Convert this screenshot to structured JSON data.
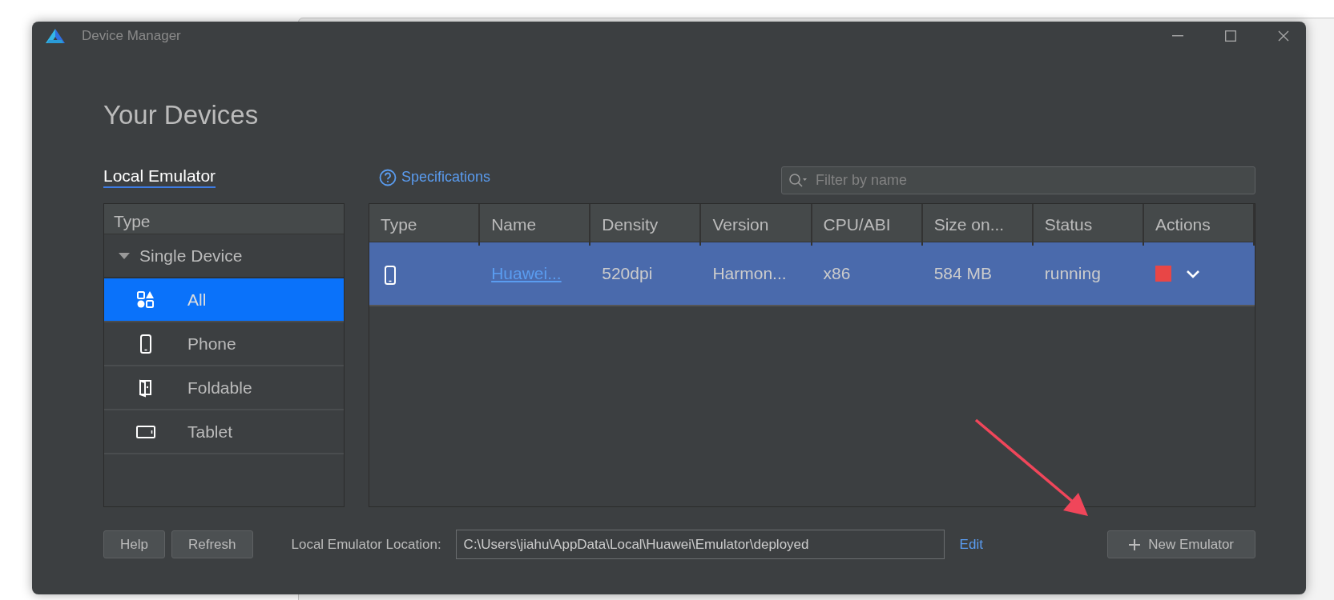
{
  "window": {
    "title": "Device Manager"
  },
  "heading": "Your Devices",
  "tabs": [
    {
      "label": "Local Emulator",
      "selected": true
    }
  ],
  "specifications_link": "Specifications",
  "filter": {
    "placeholder": "Filter by name"
  },
  "type_panel": {
    "header": "Type",
    "groups": [
      {
        "label": "Single Device",
        "expanded": true,
        "children": [
          {
            "label": "All",
            "kind": "all",
            "selected": true
          },
          {
            "label": "Phone",
            "kind": "phone",
            "selected": false
          },
          {
            "label": "Foldable",
            "kind": "foldable",
            "selected": false
          },
          {
            "label": "Tablet",
            "kind": "tablet",
            "selected": false
          }
        ]
      }
    ]
  },
  "table": {
    "columns": [
      "Type",
      "Name",
      "Density",
      "Version",
      "CPU/ABI",
      "Size on...",
      "Status",
      "Actions"
    ],
    "rows": [
      {
        "kind": "phone",
        "name": "Huawei...",
        "density": "520dpi",
        "version": "Harmon...",
        "cpu_abi": "x86",
        "size": "584 MB",
        "status": "running",
        "selected": true
      }
    ]
  },
  "footer": {
    "buttons": [
      "Help",
      "Refresh"
    ],
    "location_label": "Local Emulator Location:",
    "location_value": "C:\\Users\\jiahu\\AppData\\Local\\Huawei\\Emulator\\deployed",
    "edit_link": "Edit",
    "new_button": "New Emulator"
  }
}
